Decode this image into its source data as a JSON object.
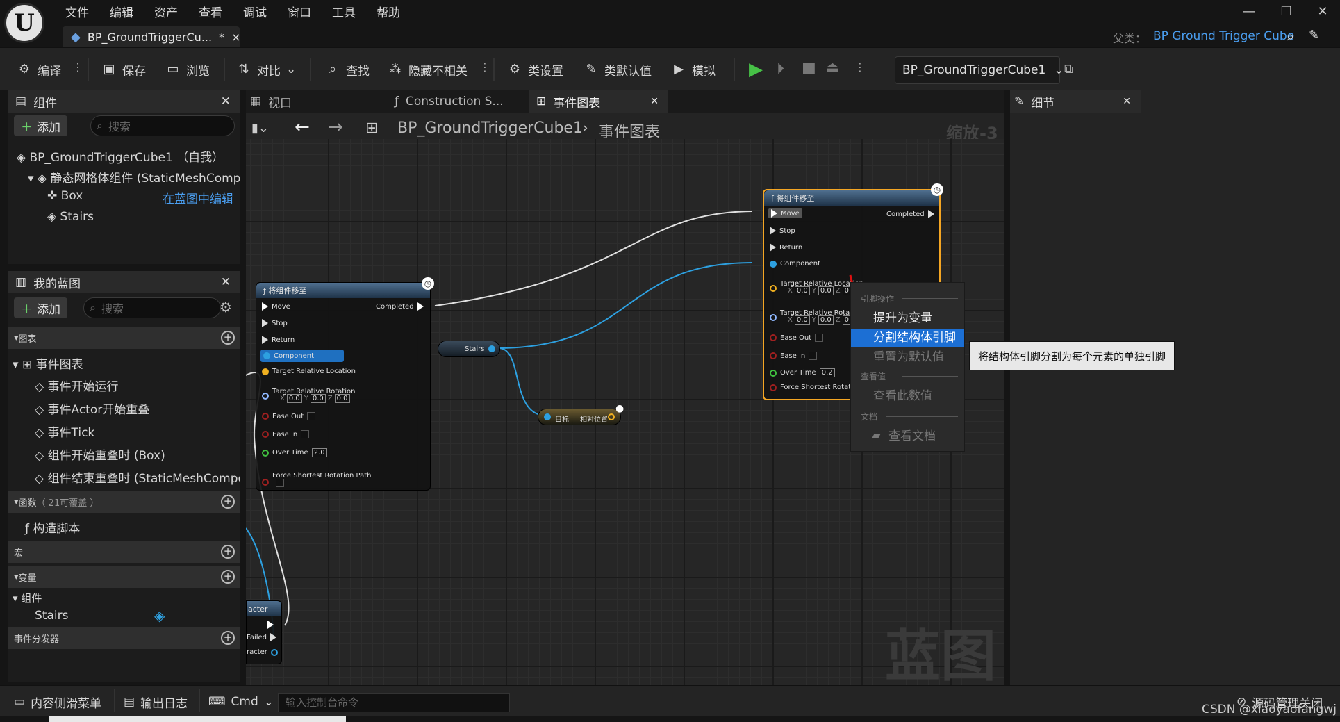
{
  "menu": [
    "文件",
    "编辑",
    "资产",
    "查看",
    "调试",
    "窗口",
    "工具",
    "帮助"
  ],
  "doc_tab": {
    "title": "BP_GroundTriggerCu...",
    "modified": "*",
    "close": "×"
  },
  "parent": {
    "label": "父类：",
    "value": "BP Ground Trigger Cube"
  },
  "toolbar": {
    "compile": "编译",
    "save": "保存",
    "browse": "浏览",
    "diff": "对比",
    "find": "查找",
    "hide_unrelated": "隐藏不相关",
    "class_settings": "类设置",
    "class_defaults": "类默认值",
    "simulate": "模拟",
    "debug_object": "BP_GroundTriggerCube1"
  },
  "components_panel": {
    "title": "组件",
    "add": "添加",
    "search_placeholder": "搜索",
    "tree": {
      "root": "BP_GroundTriggerCube1 （自我）",
      "mesh": "静态网格体组件 (StaticMeshComp",
      "box": "Box",
      "edit_link": "在蓝图中编辑",
      "stairs": "Stairs"
    }
  },
  "my_blueprint": {
    "title": "我的蓝图",
    "add": "添加",
    "search_placeholder": "搜索",
    "graphs_label": "图表",
    "event_graph": "事件图表",
    "events": [
      "事件开始运行",
      "事件Actor开始重叠",
      "事件Tick",
      "组件开始重叠时 (Box)",
      "组件结束重叠时 (StaticMeshCompo"
    ],
    "functions_label": "函数",
    "functions_count": "（ 21可覆盖 ）",
    "construction_script": "构造脚本",
    "macros_label": "宏",
    "variables_label": "变量",
    "components_label": "组件",
    "var_stairs": "Stairs",
    "dispatchers_label": "事件分发器"
  },
  "editor_tabs": {
    "viewport": "视口",
    "construction": "Construction S...",
    "event_graph": "事件图表",
    "details": "细节"
  },
  "graph": {
    "breadcrumb_bp": "BP_GroundTriggerCube1",
    "breadcrumb_graph": "事件图表",
    "zoom": "缩放-3",
    "watermark": "蓝图"
  },
  "node_left": {
    "title": "将组件移至",
    "move": "Move",
    "completed": "Completed",
    "stop": "Stop",
    "return": "Return",
    "component": "Component",
    "target_loc": "Target Relative Location",
    "target_rot": "Target Relative Rotation",
    "x": "X",
    "y": "Y",
    "z": "Z",
    "v": "0.0",
    "ease_out": "Ease Out",
    "ease_in": "Ease In",
    "over_time": "Over Time",
    "over_time_val": "2.0",
    "force": "Force Shortest Rotation Path"
  },
  "node_right": {
    "title": "将组件移至",
    "move": "Move",
    "completed": "Completed",
    "stop": "Stop",
    "return": "Return",
    "component": "Component",
    "target_loc": "Target Relative Location",
    "target_rot": "Target Relative Rotation",
    "x": "X",
    "y": "Y",
    "z": "Z",
    "v": "0.0",
    "v_cut": "0.",
    "ease_out": "Ease Out",
    "ease_in": "Ease In",
    "over_time": "Over Time",
    "over_time_val": "0.2",
    "force": "Force Shortest Rotation F"
  },
  "stairs_node": "Stairs",
  "rel_node": {
    "target": "目标",
    "output": "相对位置"
  },
  "cut_node": {
    "title": "acter",
    "failed": "Failed",
    "other": "racter"
  },
  "context_menu": {
    "pin_actions": "引脚操作",
    "promote": "提升为变量",
    "split": "分割结构体引脚",
    "reset": "重置为默认值",
    "watch_header": "查看值",
    "watch": "查看此数值",
    "docs_header": "文档",
    "view_docs": "查看文档"
  },
  "tooltip": "将结构体引脚分割为每个元素的单独引脚",
  "bottom": {
    "content_drawer": "内容侧滑菜单",
    "output_log": "输出日志",
    "cmd": "Cmd",
    "console_placeholder": "输入控制台命令",
    "source_control": "源码管理关闭",
    "watermark": "CSDN @xiaoyaofangwj"
  },
  "colors": {
    "accent_blue": "#2277dd",
    "selected_border": "#f5a623",
    "wire_blue": "#2da0e0",
    "play_green": "#46c046"
  }
}
